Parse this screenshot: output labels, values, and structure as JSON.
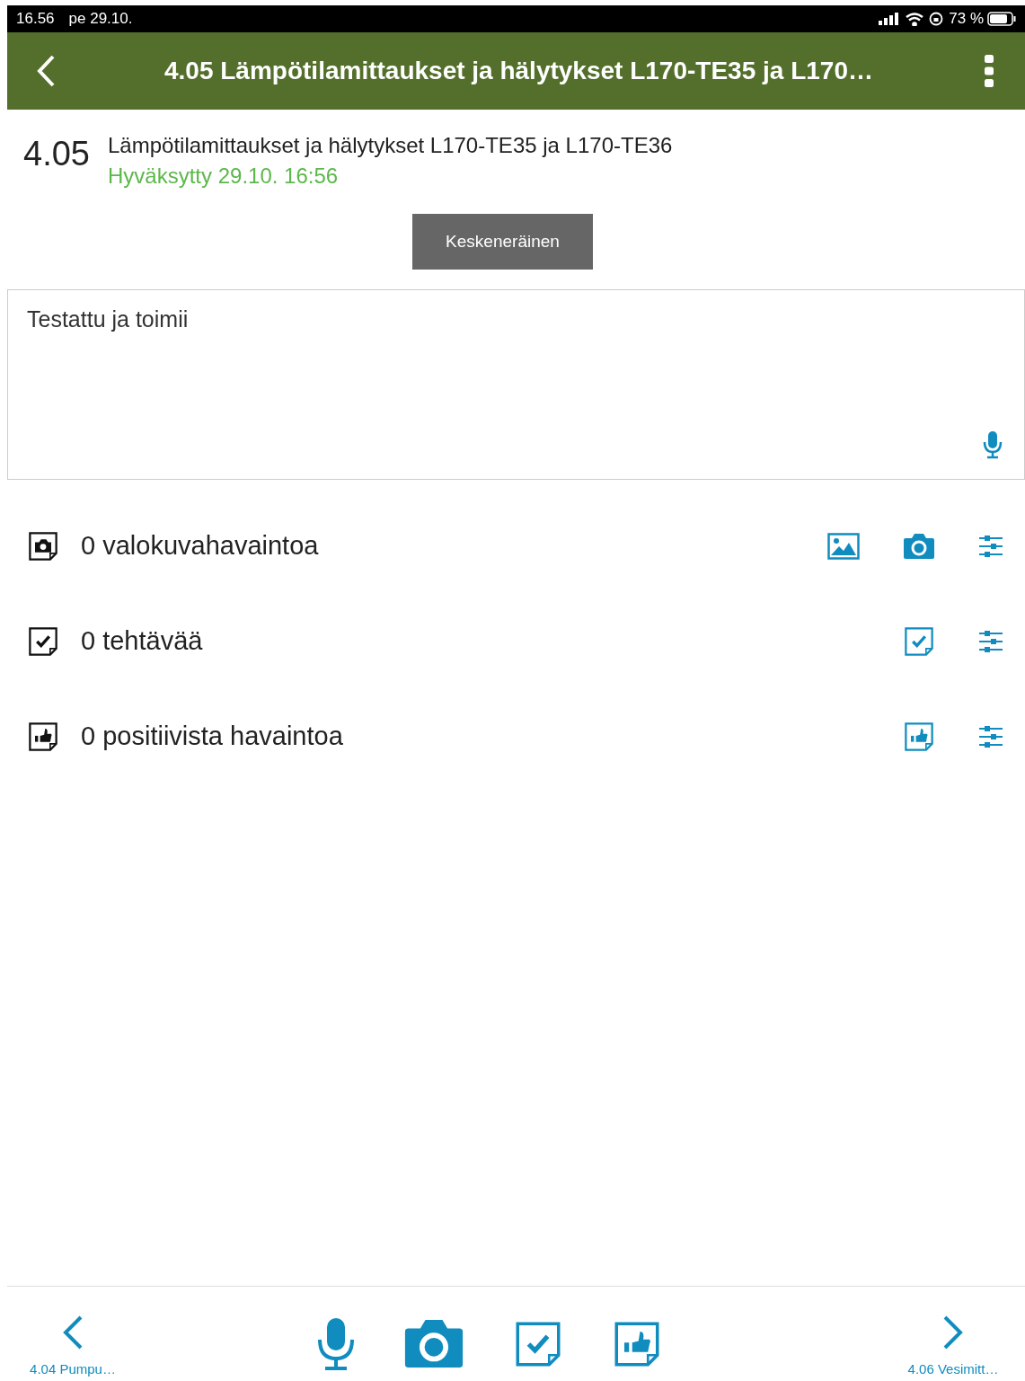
{
  "status_bar": {
    "time": "16.56",
    "date": "pe 29.10.",
    "battery": "73 %"
  },
  "header": {
    "title": "4.05 Lämpötilamittaukset ja hälytykset L170-TE35 ja L170…"
  },
  "item": {
    "number": "4.05",
    "title": "Lämpötilamittaukset ja hälytykset L170-TE35 ja L170-TE36",
    "status": "Hyväksytty 29.10. 16:56",
    "action_button": "Keskeneräinen"
  },
  "note": {
    "value": "Testattu ja toimii"
  },
  "rows": [
    {
      "kind": "photo",
      "label": "0 valokuvahavaintoa"
    },
    {
      "kind": "task",
      "label": "0 tehtävää"
    },
    {
      "kind": "positive",
      "label": "0 positiivista havaintoa"
    }
  ],
  "footer": {
    "previous": "4.04 Pumpu…",
    "next": "4.06 Vesimitt…"
  }
}
